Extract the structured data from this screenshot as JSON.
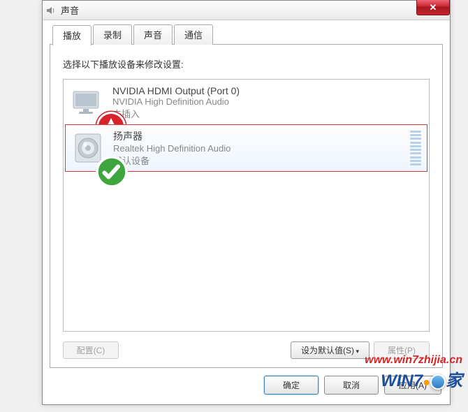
{
  "window": {
    "title": "声音"
  },
  "tabs": {
    "playback": "播放",
    "recording": "录制",
    "sounds": "声音",
    "communications": "通信"
  },
  "panel": {
    "instruction": "选择以下播放设备来修改设置:"
  },
  "devices": [
    {
      "name": "NVIDIA HDMI Output (Port 0)",
      "driver": "NVIDIA High Definition Audio",
      "status": "未插入"
    },
    {
      "name": "扬声器",
      "driver": "Realtek High Definition Audio",
      "status": "默认设备"
    }
  ],
  "panel_buttons": {
    "configure": "配置(C)",
    "set_default": "设为默认值(S)",
    "properties": "属性(P)"
  },
  "footer": {
    "ok": "确定",
    "cancel": "取消",
    "apply": "应用(A)"
  },
  "watermark": {
    "url": "www.win7zhijia.cn",
    "logo_win": "WIN",
    "logo_7": "7",
    "logo_suffix": "家"
  }
}
